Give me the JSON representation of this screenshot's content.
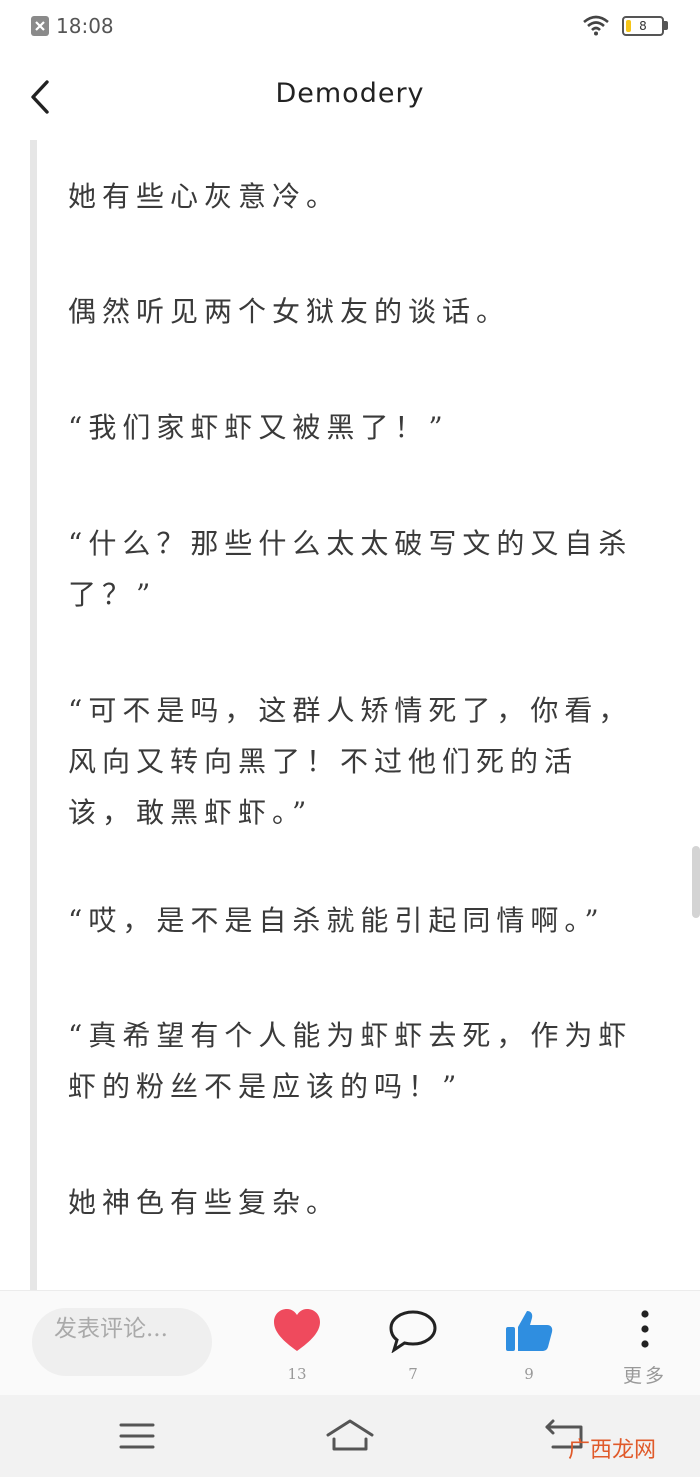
{
  "status_bar": {
    "time": "18:08",
    "battery_level": "8",
    "app_icon": "close-square-icon",
    "wifi_icon": "wifi-icon"
  },
  "header": {
    "title": "Demodery",
    "back_icon": "chevron-left-icon"
  },
  "article": {
    "paragraphs": [
      "她有些心灰意冷。",
      "偶然听见两个女狱友的谈话。",
      "“我们家虾虾又被黑了！”",
      "“什么？那些什么太太破写文的又自杀了？”",
      "“可不是吗，这群人矫情死了，你看，风向又转向黑了！不过他们死的活该，敢黑虾虾。”",
      "“哎，是不是自杀就能引起同情啊。”",
      "“真希望有个人能为虾虾去死，作为虾虾的粉丝不是应该的吗！”",
      "她神色有些复杂。"
    ]
  },
  "action_bar": {
    "comment_placeholder": "发表评论...",
    "like_count": "13",
    "comment_count": "7",
    "thumb_count": "9",
    "more_label": "更多",
    "colors": {
      "heart": "#ef4a5d",
      "thumb": "#2f8ee0"
    }
  },
  "nav_bar": {
    "menu_icon": "menu-icon",
    "home_icon": "home-icon",
    "back_icon": "back-arrow-icon"
  },
  "watermark": "广西龙网"
}
